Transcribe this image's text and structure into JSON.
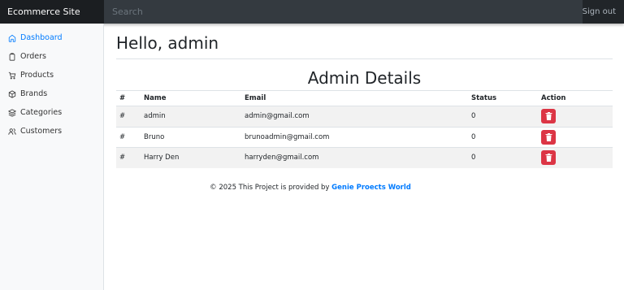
{
  "header": {
    "brand": "Ecommerce Site",
    "search_placeholder": "Search",
    "signout_label": "Sign out"
  },
  "sidebar": {
    "items": [
      {
        "label": "Dashboard",
        "icon": "home-icon",
        "active": true
      },
      {
        "label": "Orders",
        "icon": "file-icon",
        "active": false
      },
      {
        "label": "Products",
        "icon": "cart-icon",
        "active": false
      },
      {
        "label": "Brands",
        "icon": "box-icon",
        "active": false
      },
      {
        "label": "Categories",
        "icon": "layers-icon",
        "active": false
      },
      {
        "label": "Customers",
        "icon": "users-icon",
        "active": false
      }
    ]
  },
  "main": {
    "greeting": "Hello, admin",
    "section_title": "Admin Details",
    "table": {
      "headers": [
        "#",
        "Name",
        "Email",
        "Status",
        "Action"
      ],
      "rows": [
        {
          "idx": "#",
          "name": "admin",
          "email": "admin@gmail.com",
          "status": "0"
        },
        {
          "idx": "#",
          "name": "Bruno",
          "email": "brunoadmin@gmail.com",
          "status": "0"
        },
        {
          "idx": "#",
          "name": "Harry Den",
          "email": "harryden@gmail.com",
          "status": "0"
        }
      ]
    }
  },
  "footer": {
    "text": "© 2025 This Project is provided by ",
    "link": "Genie Proects World"
  },
  "colors": {
    "accent": "#007bff",
    "danger": "#dc3545",
    "topbar": "#212529"
  }
}
